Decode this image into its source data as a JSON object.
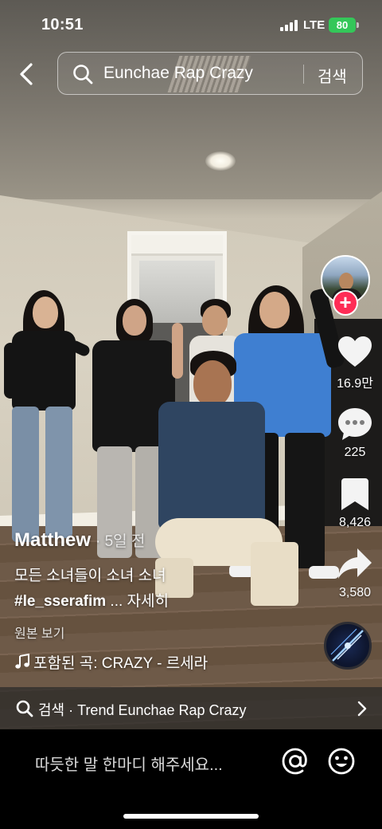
{
  "status_bar": {
    "time": "10:51",
    "network": "LTE",
    "battery": "80"
  },
  "search": {
    "query": "Eunchae Rap Crazy",
    "submit_label": "검색"
  },
  "rail": {
    "likes": "16.9만",
    "comments": "225",
    "saves": "8,426",
    "shares": "3,580"
  },
  "post": {
    "author": "Matthew",
    "age": "· 5일 전",
    "description": "모든 소녀들이 소녀 소녀",
    "hashtag": "#le_sserafim",
    "more": " ... 자세히",
    "original_label": "원본 보기",
    "song": "포함된 곡: CRAZY - 르세라"
  },
  "banner": {
    "text": "검색 · Trend Eunchae Rap Crazy"
  },
  "comment": {
    "placeholder": "따듯한 말 한마디 해주세요..."
  },
  "icons": {
    "back": "back-arrow-icon",
    "search": "search-icon",
    "follow": "plus-icon",
    "like": "heart-icon",
    "comment": "comment-bubble-icon",
    "save": "bookmark-icon",
    "share": "share-arrow-icon",
    "music": "music-note-icon",
    "mention": "at-icon",
    "emoji": "emoji-icon"
  },
  "colors": {
    "accent": "#fe2c55",
    "battery": "#34c759"
  }
}
